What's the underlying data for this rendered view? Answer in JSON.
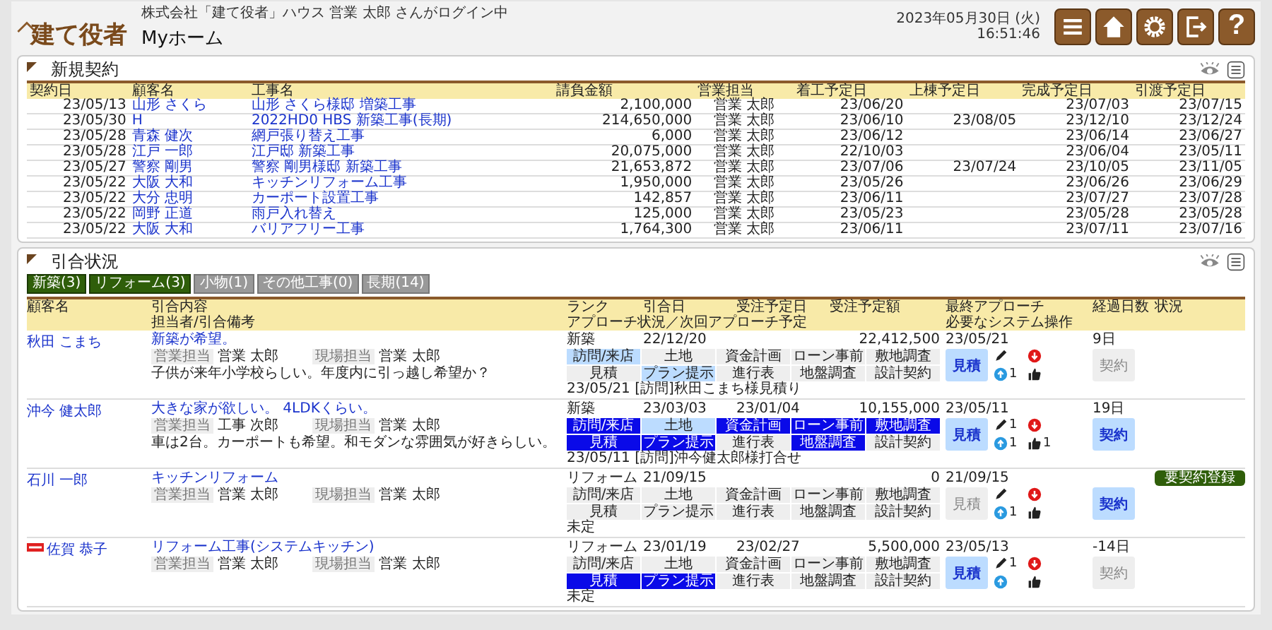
{
  "header": {
    "logo": "建て役者",
    "login": "株式会社「建て役者」ハウス 営業 太郎 さんがログイン中",
    "page_title": "Myホーム",
    "date": "2023年05月30日 (火)",
    "time": "16:51:46",
    "buttons": [
      {
        "kind": "menu"
      },
      {
        "kind": "home"
      },
      {
        "kind": "settings"
      },
      {
        "kind": "logout"
      },
      {
        "kind": "help",
        "text": "?"
      }
    ]
  },
  "contracts": {
    "title": "新規契約",
    "columns": [
      {
        "label": "契約日",
        "kind": "date"
      },
      {
        "label": "顧客名",
        "kind": "link"
      },
      {
        "label": "工事名",
        "kind": "link"
      },
      {
        "label": "請負金額",
        "kind": "amount"
      },
      {
        "label": "営業担当",
        "kind": "text"
      },
      {
        "label": "着工予定日",
        "kind": "date"
      },
      {
        "label": "上棟予定日",
        "kind": "date"
      },
      {
        "label": "完成予定日",
        "kind": "date"
      },
      {
        "label": "引渡予定日",
        "kind": "date"
      }
    ],
    "rows": [
      [
        "23/05/13",
        "山形 さくら",
        "山形 さくら様邸 増築工事",
        "2,100,000",
        "営業 太郎",
        "23/06/20",
        null,
        "23/07/03",
        "23/07/15"
      ],
      [
        "23/05/30",
        "H",
        "2022HD0 HBS 新築工事(長期)",
        "214,650,000",
        "営業 太郎",
        "23/06/10",
        "23/08/05",
        "23/12/10",
        "23/12/24"
      ],
      [
        "23/05/28",
        "青森 健次",
        "網戸張り替え工事",
        "6,000",
        "営業 太郎",
        "23/06/12",
        null,
        "23/06/14",
        "23/06/27"
      ],
      [
        "23/05/28",
        "江戸 一郎",
        "江戸邸 新築工事",
        "20,075,000",
        "営業 太郎",
        "22/10/03",
        null,
        "23/06/04",
        "23/05/11"
      ],
      [
        "23/05/27",
        "警察 剛男",
        "警察 剛男様邸 新築工事",
        "21,653,872",
        "営業 太郎",
        "23/07/06",
        "23/07/24",
        "23/10/05",
        "23/11/05"
      ],
      [
        "23/05/22",
        "大阪 大和",
        "キッチンリフォーム工事",
        "1,950,000",
        "営業 太郎",
        "23/05/26",
        null,
        "23/06/26",
        "23/06/29"
      ],
      [
        "23/05/22",
        "大分 忠明",
        "カーポート設置工事",
        "142,857",
        "営業 太郎",
        "23/06/11",
        null,
        "23/07/27",
        "23/07/28"
      ],
      [
        "23/05/22",
        "岡野 正道",
        "雨戸入れ替え",
        "125,000",
        "営業 太郎",
        "23/05/23",
        null,
        "23/05/28",
        "23/05/28"
      ],
      [
        "23/05/22",
        "大阪 大和",
        "バリアフリー工事",
        "1,764,300",
        "営業 太郎",
        "23/06/11",
        null,
        "23/07/11",
        "23/07/16"
      ]
    ]
  },
  "inquiries": {
    "title": "引合状況",
    "filters": [
      {
        "label": "新築(3)",
        "selected": true
      },
      {
        "label": "リフォーム(3)",
        "selected": true
      },
      {
        "label": "小物(1)",
        "selected": false
      },
      {
        "label": "その他工事(0)",
        "selected": false
      },
      {
        "label": "長期(14)",
        "selected": false
      }
    ],
    "header": {
      "customer": "顧客名",
      "content": "引合内容",
      "content_sub": "担当者/引合備考",
      "middle": [
        "ランク",
        "引合日",
        "受注予定日",
        "受注予定額"
      ],
      "middle_sub": "アプローチ状況／次回アプローチ予定",
      "approach": "最終アプローチ",
      "approach_sub": "必要なシステム操作",
      "elapsed": "経過日数",
      "status": "状況"
    },
    "rows": [
      {
        "customer": "秋田 こまち",
        "tagged": false,
        "content": "新築が希望。",
        "reps": [
          {
            "label": "営業担当",
            "name": "営業 太郎"
          },
          {
            "label": "現場担当",
            "name": "営業 太郎"
          }
        ],
        "remark": "子供が来年小学校らしい。年度内に引っ越し希望か？",
        "rank": "新築",
        "inquiry_date": "22/12/20",
        "amount": "22,412,500",
        "steps": [
          {
            "label": "訪問/来店",
            "done": false,
            "highlighted": true
          },
          {
            "label": "土地",
            "done": false,
            "highlighted": false
          },
          {
            "label": "資金計画",
            "done": false,
            "highlighted": false
          },
          {
            "label": "ローン事前",
            "done": false,
            "highlighted": false
          },
          {
            "label": "敷地調査",
            "done": false,
            "highlighted": false
          },
          {
            "label": "見積",
            "done": false,
            "highlighted": false
          },
          {
            "label": "プラン提示",
            "done": false,
            "highlighted": true
          },
          {
            "label": "進行表",
            "done": false,
            "highlighted": false
          },
          {
            "label": "地盤調査",
            "done": false,
            "highlighted": false
          },
          {
            "label": "設計契約",
            "done": false,
            "highlighted": false
          }
        ],
        "note": "23/05/21 [訪問]秋田こまち様見積り",
        "last_approach": "23/05/21",
        "elapsed": "9日",
        "estimate": {
          "label": "見積",
          "active": true
        },
        "contract": {
          "label": "契約",
          "active": false
        },
        "up_count": "1"
      },
      {
        "customer": "沖今 健太郎",
        "tagged": false,
        "content": "大きな家が欲しい。 4LDKくらい。",
        "reps": [
          {
            "label": "営業担当",
            "name": "工事 次郎"
          },
          {
            "label": "現場担当",
            "name": "営業 太郎"
          }
        ],
        "remark": "車は2台。カーポートも希望。和モダンな雰囲気が好きらしい。",
        "rank": "新築",
        "inquiry_date": "23/03/03",
        "order_date": "23/01/04",
        "amount": "10,155,000",
        "steps": [
          {
            "label": "訪問/来店",
            "done": true,
            "highlighted": false
          },
          {
            "label": "土地",
            "done": false,
            "highlighted": true
          },
          {
            "label": "資金計画",
            "done": true,
            "highlighted": false
          },
          {
            "label": "ローン事前",
            "done": true,
            "highlighted": false
          },
          {
            "label": "敷地調査",
            "done": true,
            "highlighted": false
          },
          {
            "label": "見積",
            "done": true,
            "highlighted": false
          },
          {
            "label": "プラン提示",
            "done": true,
            "highlighted": false
          },
          {
            "label": "進行表",
            "done": false,
            "highlighted": false
          },
          {
            "label": "地盤調査",
            "done": true,
            "highlighted": false
          },
          {
            "label": "設計契約",
            "done": false,
            "highlighted": false
          }
        ],
        "note": "23/05/11 [訪問]沖今健太郎様打合せ",
        "last_approach": "23/05/11",
        "elapsed": "19日",
        "estimate": {
          "label": "見積",
          "active": true
        },
        "contract": {
          "label": "契約",
          "active": true
        },
        "edit_count": "1",
        "up_count": "1",
        "like_count": "1"
      },
      {
        "customer": "石川 一郎",
        "tagged": false,
        "content": "キッチンリフォーム",
        "reps": [
          {
            "label": "営業担当",
            "name": "営業 太郎"
          },
          {
            "label": "現場担当",
            "name": "営業 太郎"
          }
        ],
        "rank": "リフォーム",
        "inquiry_date": "21/09/15",
        "amount": "0",
        "steps": [
          {
            "label": "訪問/来店",
            "done": false,
            "highlighted": false
          },
          {
            "label": "土地",
            "done": false,
            "highlighted": false
          },
          {
            "label": "資金計画",
            "done": false,
            "highlighted": false
          },
          {
            "label": "ローン事前",
            "done": false,
            "highlighted": false
          },
          {
            "label": "敷地調査",
            "done": false,
            "highlighted": false
          },
          {
            "label": "見積",
            "done": false,
            "highlighted": false
          },
          {
            "label": "プラン提示",
            "done": false,
            "highlighted": false
          },
          {
            "label": "進行表",
            "done": false,
            "highlighted": false
          },
          {
            "label": "地盤調査",
            "done": false,
            "highlighted": false
          },
          {
            "label": "設計契約",
            "done": false,
            "highlighted": false
          }
        ],
        "note": "未定",
        "last_approach": "21/09/15",
        "estimate": {
          "label": "見積",
          "active": false
        },
        "contract": {
          "label": "契約",
          "active": true
        },
        "up_count": "1",
        "status": "要契約登録"
      },
      {
        "customer": "佐賀 恭子",
        "tagged": true,
        "content": "リフォーム工事(システムキッチン)",
        "reps": [
          {
            "label": "営業担当",
            "name": "営業 太郎"
          },
          {
            "label": "現場担当",
            "name": "営業 太郎"
          }
        ],
        "rank": "リフォーム",
        "inquiry_date": "23/01/19",
        "order_date": "23/02/27",
        "amount": "5,500,000",
        "steps": [
          {
            "label": "訪問/来店",
            "done": false,
            "highlighted": false
          },
          {
            "label": "土地",
            "done": false,
            "highlighted": false
          },
          {
            "label": "資金計画",
            "done": false,
            "highlighted": false
          },
          {
            "label": "ローン事前",
            "done": false,
            "highlighted": false
          },
          {
            "label": "敷地調査",
            "done": false,
            "highlighted": false
          },
          {
            "label": "見積",
            "done": true,
            "highlighted": false
          },
          {
            "label": "プラン提示",
            "done": true,
            "highlighted": false
          },
          {
            "label": "進行表",
            "done": false,
            "highlighted": false
          },
          {
            "label": "地盤調査",
            "done": false,
            "highlighted": false
          },
          {
            "label": "設計契約",
            "done": false,
            "highlighted": false
          }
        ],
        "note": "未定",
        "last_approach": "23/05/13",
        "elapsed": "-14日",
        "estimate": {
          "label": "見積",
          "active": true
        },
        "contract": {
          "label": "契約",
          "active": false
        },
        "edit_count": "1"
      }
    ]
  }
}
